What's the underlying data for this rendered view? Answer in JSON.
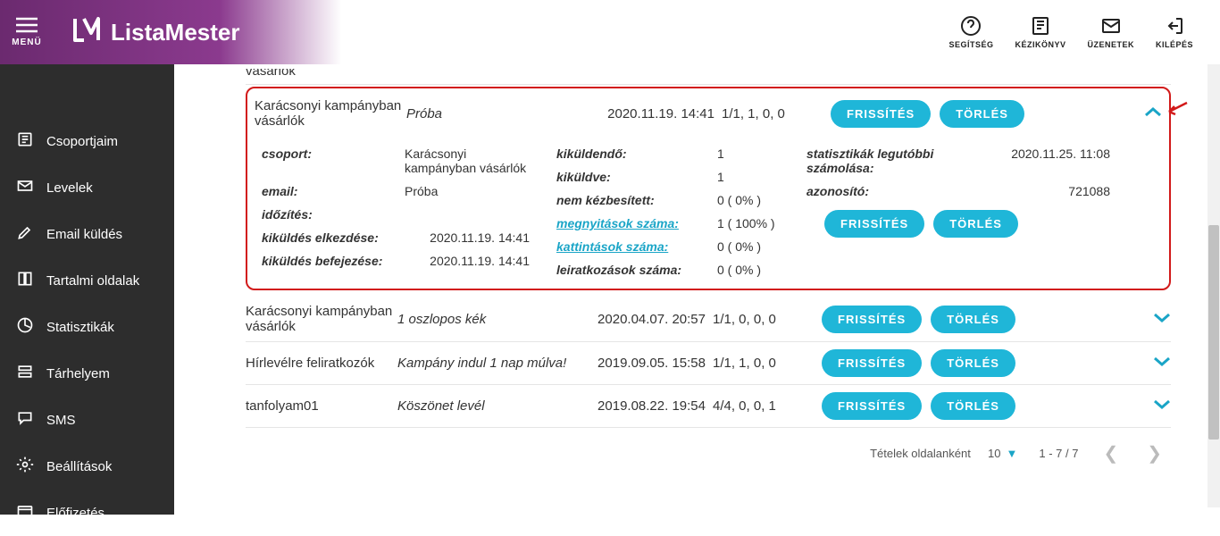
{
  "topbar": {
    "menu_label": "MENÜ",
    "logo_text": "ListaMester",
    "actions": [
      {
        "name": "help",
        "label": "SEGÍTSÉG"
      },
      {
        "name": "manual",
        "label": "KÉZIKÖNYV"
      },
      {
        "name": "messages",
        "label": "ÜZENETEK"
      },
      {
        "name": "logout",
        "label": "KILÉPÉS"
      }
    ]
  },
  "sidebar": {
    "items": [
      {
        "name": "groups",
        "label": "Csoportjaim"
      },
      {
        "name": "letters",
        "label": "Levelek"
      },
      {
        "name": "send",
        "label": "Email küldés"
      },
      {
        "name": "content",
        "label": "Tartalmi oldalak"
      },
      {
        "name": "stats",
        "label": "Statisztikák"
      },
      {
        "name": "storage",
        "label": "Tárhelyem"
      },
      {
        "name": "sms",
        "label": "SMS"
      },
      {
        "name": "settings",
        "label": "Beállítások"
      },
      {
        "name": "subscription",
        "label": "Előfizetés"
      }
    ]
  },
  "buttons": {
    "refresh": "FRISSÍTÉS",
    "delete": "TÖRLÉS"
  },
  "partial_above_text": "vásárlók",
  "rows": [
    {
      "group": "Karácsonyi kampányban vásárlók",
      "email_name": "Próba",
      "time": "2020.11.19. 14:41",
      "stats": "1/1, 1, 0, 0",
      "expanded": true
    },
    {
      "group": "Karácsonyi kampányban vásárlók",
      "email_name": "1 oszlopos kék",
      "time": "2020.04.07. 20:57",
      "stats": "1/1, 0, 0, 0",
      "expanded": false
    },
    {
      "group": "Hírlevélre feliratkozók",
      "email_name": "Kampány indul 1 nap múlva!",
      "time": "2019.09.05. 15:58",
      "stats": "1/1, 1, 0, 0",
      "expanded": false
    },
    {
      "group": "tanfolyam01",
      "email_name": "Köszönet levél",
      "time": "2019.08.22. 19:54",
      "stats": "4/4, 0, 0, 1",
      "expanded": false
    }
  ],
  "detail": {
    "col1": {
      "labels": {
        "group": "csoport:",
        "email": "email:",
        "schedule": "időzítés:",
        "send_start": "kiküldés elkezdése:",
        "send_end": "kiküldés befejezése:"
      },
      "values": {
        "group": "Karácsonyi kampányban vásárlók",
        "email": "Próba",
        "schedule": "",
        "send_start": "2020.11.19. 14:41",
        "send_end": "2020.11.19. 14:41"
      }
    },
    "col2": {
      "labels": {
        "to_send": "kiküldendő:",
        "sent": "kiküldve:",
        "undelivered": "nem kézbesített:",
        "opens": "megnyitások száma:",
        "clicks": "kattintások száma:",
        "unsubs": "leiratkozások száma:"
      },
      "values": {
        "to_send": "1",
        "sent": "1",
        "undelivered": "0 ( 0% )",
        "opens": "1 ( 100% )",
        "clicks": "0 ( 0% )",
        "unsubs": "0 ( 0% )"
      }
    },
    "col3": {
      "labels": {
        "stats_calc": "statisztikák legutóbbi számolása:",
        "id": "azonosító:"
      },
      "values": {
        "stats_calc": "2020.11.25. 11:08",
        "id": "721088"
      }
    }
  },
  "footer": {
    "per_page_label": "Tételek oldalanként",
    "per_page_value": "10",
    "range": "1 - 7 / 7"
  }
}
